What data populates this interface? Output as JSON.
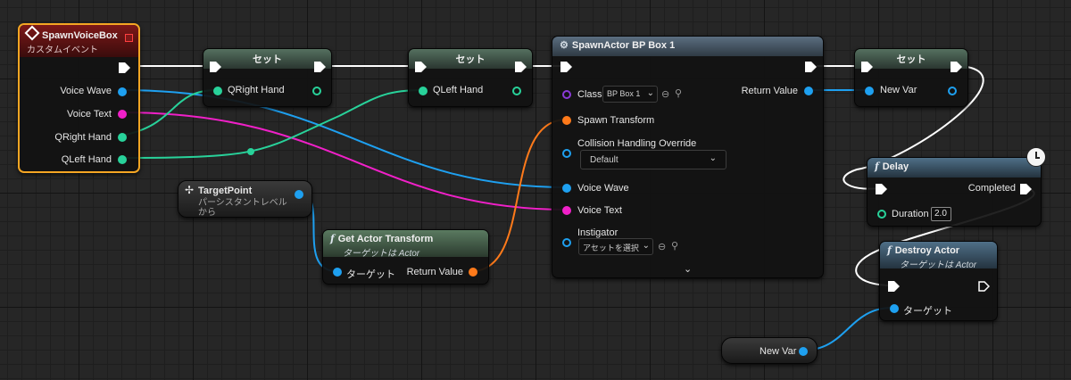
{
  "colors": {
    "exec": "#ffffff",
    "object": "#1ea0f0",
    "text": "#f020c8",
    "struct": "#28d29a",
    "transform": "#ff7a1a",
    "class": "#8a3ad8",
    "selection": "#f5a623"
  },
  "event_node": {
    "title": "SpawnVoiceBox",
    "subtitle": "カスタムイベント",
    "icon": "event-diamond-icon",
    "pins": [
      "Voice Wave",
      "Voice Text",
      "QRight Hand",
      "QLeft Hand"
    ]
  },
  "set1": {
    "title": "セット",
    "pin": "QRight Hand"
  },
  "set2": {
    "title": "セット",
    "pin": "QLeft Hand"
  },
  "spawn": {
    "title": "SpawnActor BP Box 1",
    "class_label": "Class",
    "class_value": "BP Box 1",
    "return_label": "Return Value",
    "spawn_transform": "Spawn Transform",
    "collision_label": "Collision Handling Override",
    "collision_value": "Default",
    "voice_wave": "Voice Wave",
    "voice_text": "Voice Text",
    "instigator": "Instigator",
    "instigator_value": "アセットを選択"
  },
  "set3": {
    "title": "セット",
    "pin": "New Var"
  },
  "target_point": {
    "title": "TargetPoint",
    "subtitle": "パーシスタントレベル から"
  },
  "get_transform": {
    "title": "Get Actor Transform",
    "subtitle": "ターゲットは Actor",
    "target": "ターゲット",
    "return": "Return Value"
  },
  "delay": {
    "title": "Delay",
    "completed": "Completed",
    "duration_label": "Duration",
    "duration_value": "2.0"
  },
  "destroy": {
    "title": "Destroy Actor",
    "subtitle": "ターゲットは Actor",
    "target": "ターゲット"
  },
  "new_var": {
    "label": "New Var"
  }
}
